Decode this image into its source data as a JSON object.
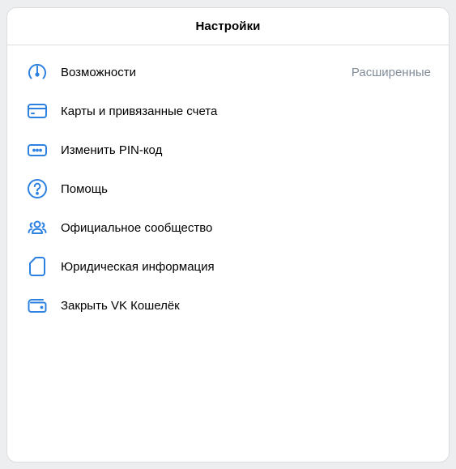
{
  "header": {
    "title": "Настройки"
  },
  "colors": {
    "accent": "#2d81e0",
    "text": "#000000",
    "secondary": "#818c99",
    "divider": "#dcdde0"
  },
  "items": [
    {
      "label": "Возможности",
      "value": "Расширенные",
      "icon": "speedometer-icon"
    },
    {
      "label": "Карты и привязанные счета",
      "icon": "credit-card-icon"
    },
    {
      "label": "Изменить PIN-код",
      "icon": "pin-code-icon"
    },
    {
      "label": "Помощь",
      "icon": "help-circle-icon"
    },
    {
      "label": "Официальное сообщество",
      "icon": "users-icon"
    },
    {
      "label": "Юридическая информация",
      "icon": "document-icon"
    },
    {
      "label": "Закрыть VK Кошелёк",
      "icon": "wallet-icon"
    }
  ]
}
